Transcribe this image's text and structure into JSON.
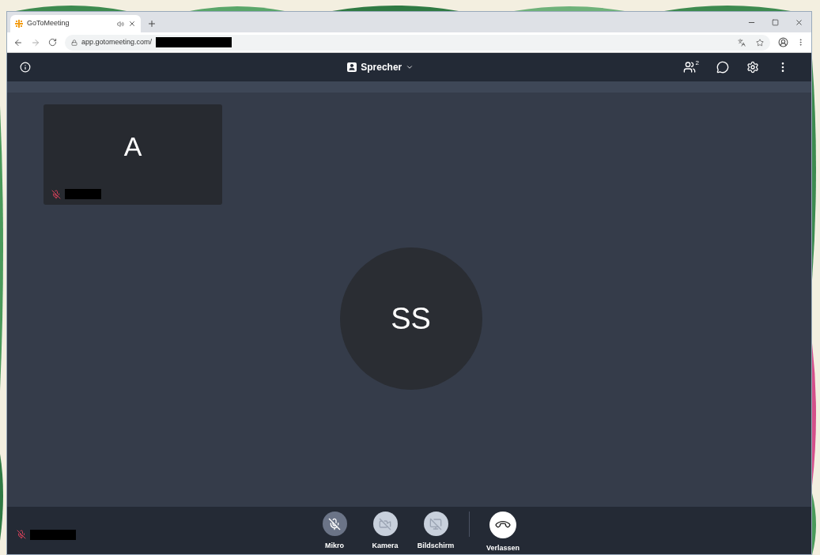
{
  "browser": {
    "tab": {
      "title": "GoToMeeting"
    },
    "url": "app.gotomeeting.com/"
  },
  "topbar": {
    "view": "Sprecher",
    "participants_count": "2"
  },
  "tile": {
    "initial": "A",
    "muted": true
  },
  "speaker": {
    "initials": "SS"
  },
  "self": {
    "muted": true
  },
  "controls": [
    {
      "kind": "mic",
      "label": "Mikro",
      "disabled": false
    },
    {
      "kind": "camera",
      "label": "Kamera",
      "disabled": true
    },
    {
      "kind": "screen",
      "label": "Bildschirm",
      "disabled": true
    },
    {
      "kind": "leave",
      "label": "Verlassen",
      "disabled": false
    }
  ]
}
